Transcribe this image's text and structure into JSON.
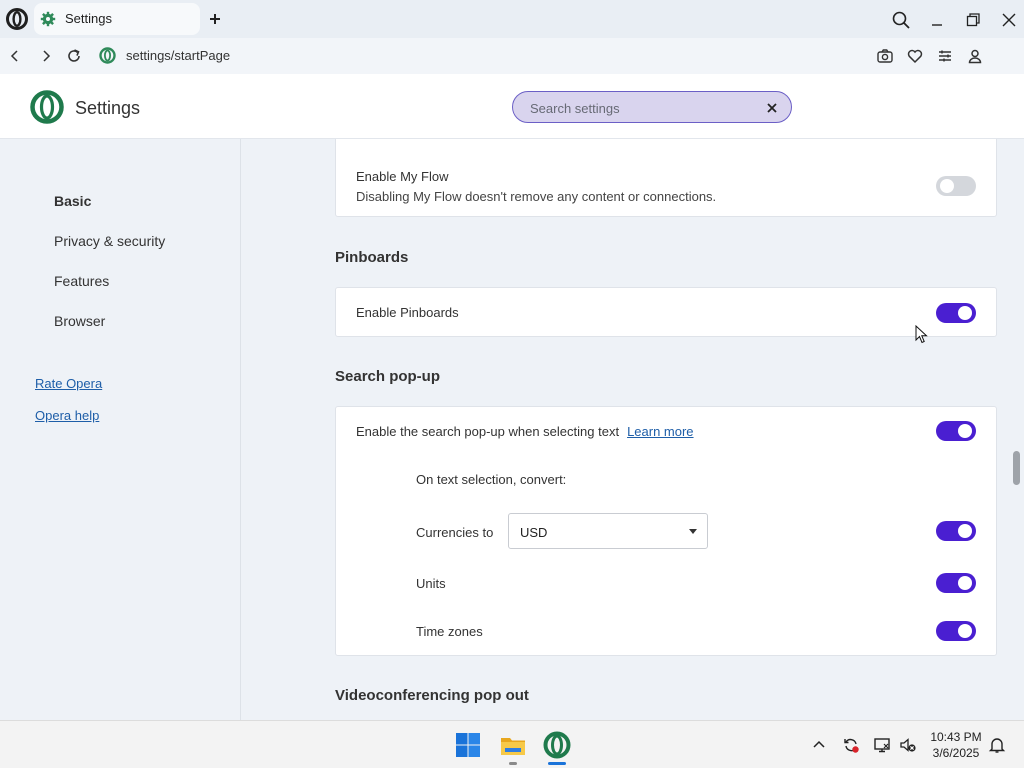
{
  "browser": {
    "tab_title": "Settings",
    "url": "settings/startPage"
  },
  "header": {
    "title": "Settings",
    "search_placeholder": "Search settings"
  },
  "sidebar": {
    "items": [
      {
        "label": "Basic",
        "active": true
      },
      {
        "label": "Privacy & security"
      },
      {
        "label": "Features"
      },
      {
        "label": "Browser"
      }
    ],
    "links": [
      "Rate Opera",
      "Opera help"
    ]
  },
  "main": {
    "myflow": {
      "label": "Enable My Flow",
      "description": "Disabling My Flow doesn't remove any content or connections.",
      "enabled": false
    },
    "pinboards": {
      "title": "Pinboards",
      "label": "Enable Pinboards",
      "enabled": true
    },
    "search_popup": {
      "title": "Search pop-up",
      "label": "Enable the search pop-up when selecting text",
      "learn_more": "Learn more",
      "enabled": true,
      "convert_label": "On text selection, convert:",
      "currencies_label": "Currencies to",
      "currency_value": "USD",
      "currencies_enabled": true,
      "units_label": "Units",
      "units_enabled": true,
      "timezones_label": "Time zones",
      "timezones_enabled": true
    },
    "videoconf": {
      "title": "Videoconferencing pop out"
    }
  },
  "taskbar": {
    "time": "10:43 PM",
    "date": "3/6/2025"
  },
  "colors": {
    "accent": "#4a1fd1",
    "opera_green": "#1f7a4c",
    "link": "#1e5ea8"
  }
}
